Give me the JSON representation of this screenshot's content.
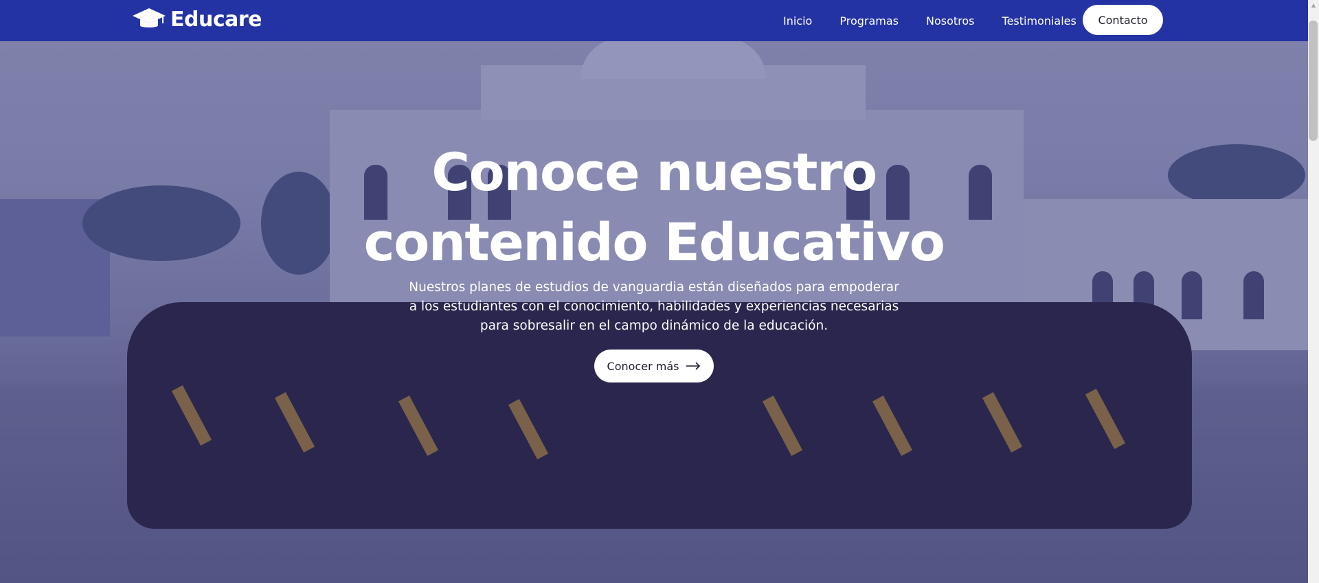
{
  "header": {
    "brand": "Educare",
    "nav": [
      {
        "label": "Inicio"
      },
      {
        "label": "Programas"
      },
      {
        "label": "Nosotros"
      },
      {
        "label": "Testimoniales"
      }
    ],
    "contact_label": "Contacto"
  },
  "hero": {
    "title_line1": "Conoce nuestro",
    "title_line2": "contenido Educativo",
    "description": "Nuestros planes de estudios de vanguardia están diseñados para empoderar a los estudiantes con el conocimiento, habilidades y experiencias necesarias para sobresalir en el campo dinámico de la educación.",
    "cta_label": "Conocer más",
    "background_description_icon": "graduation-group-photo"
  },
  "icons": {
    "brand": "graduation-cap-icon",
    "cta": "arrow-right-icon"
  },
  "colors": {
    "navbar": "#2433a3",
    "button_bg": "#ffffff",
    "text_light": "#ffffff"
  }
}
